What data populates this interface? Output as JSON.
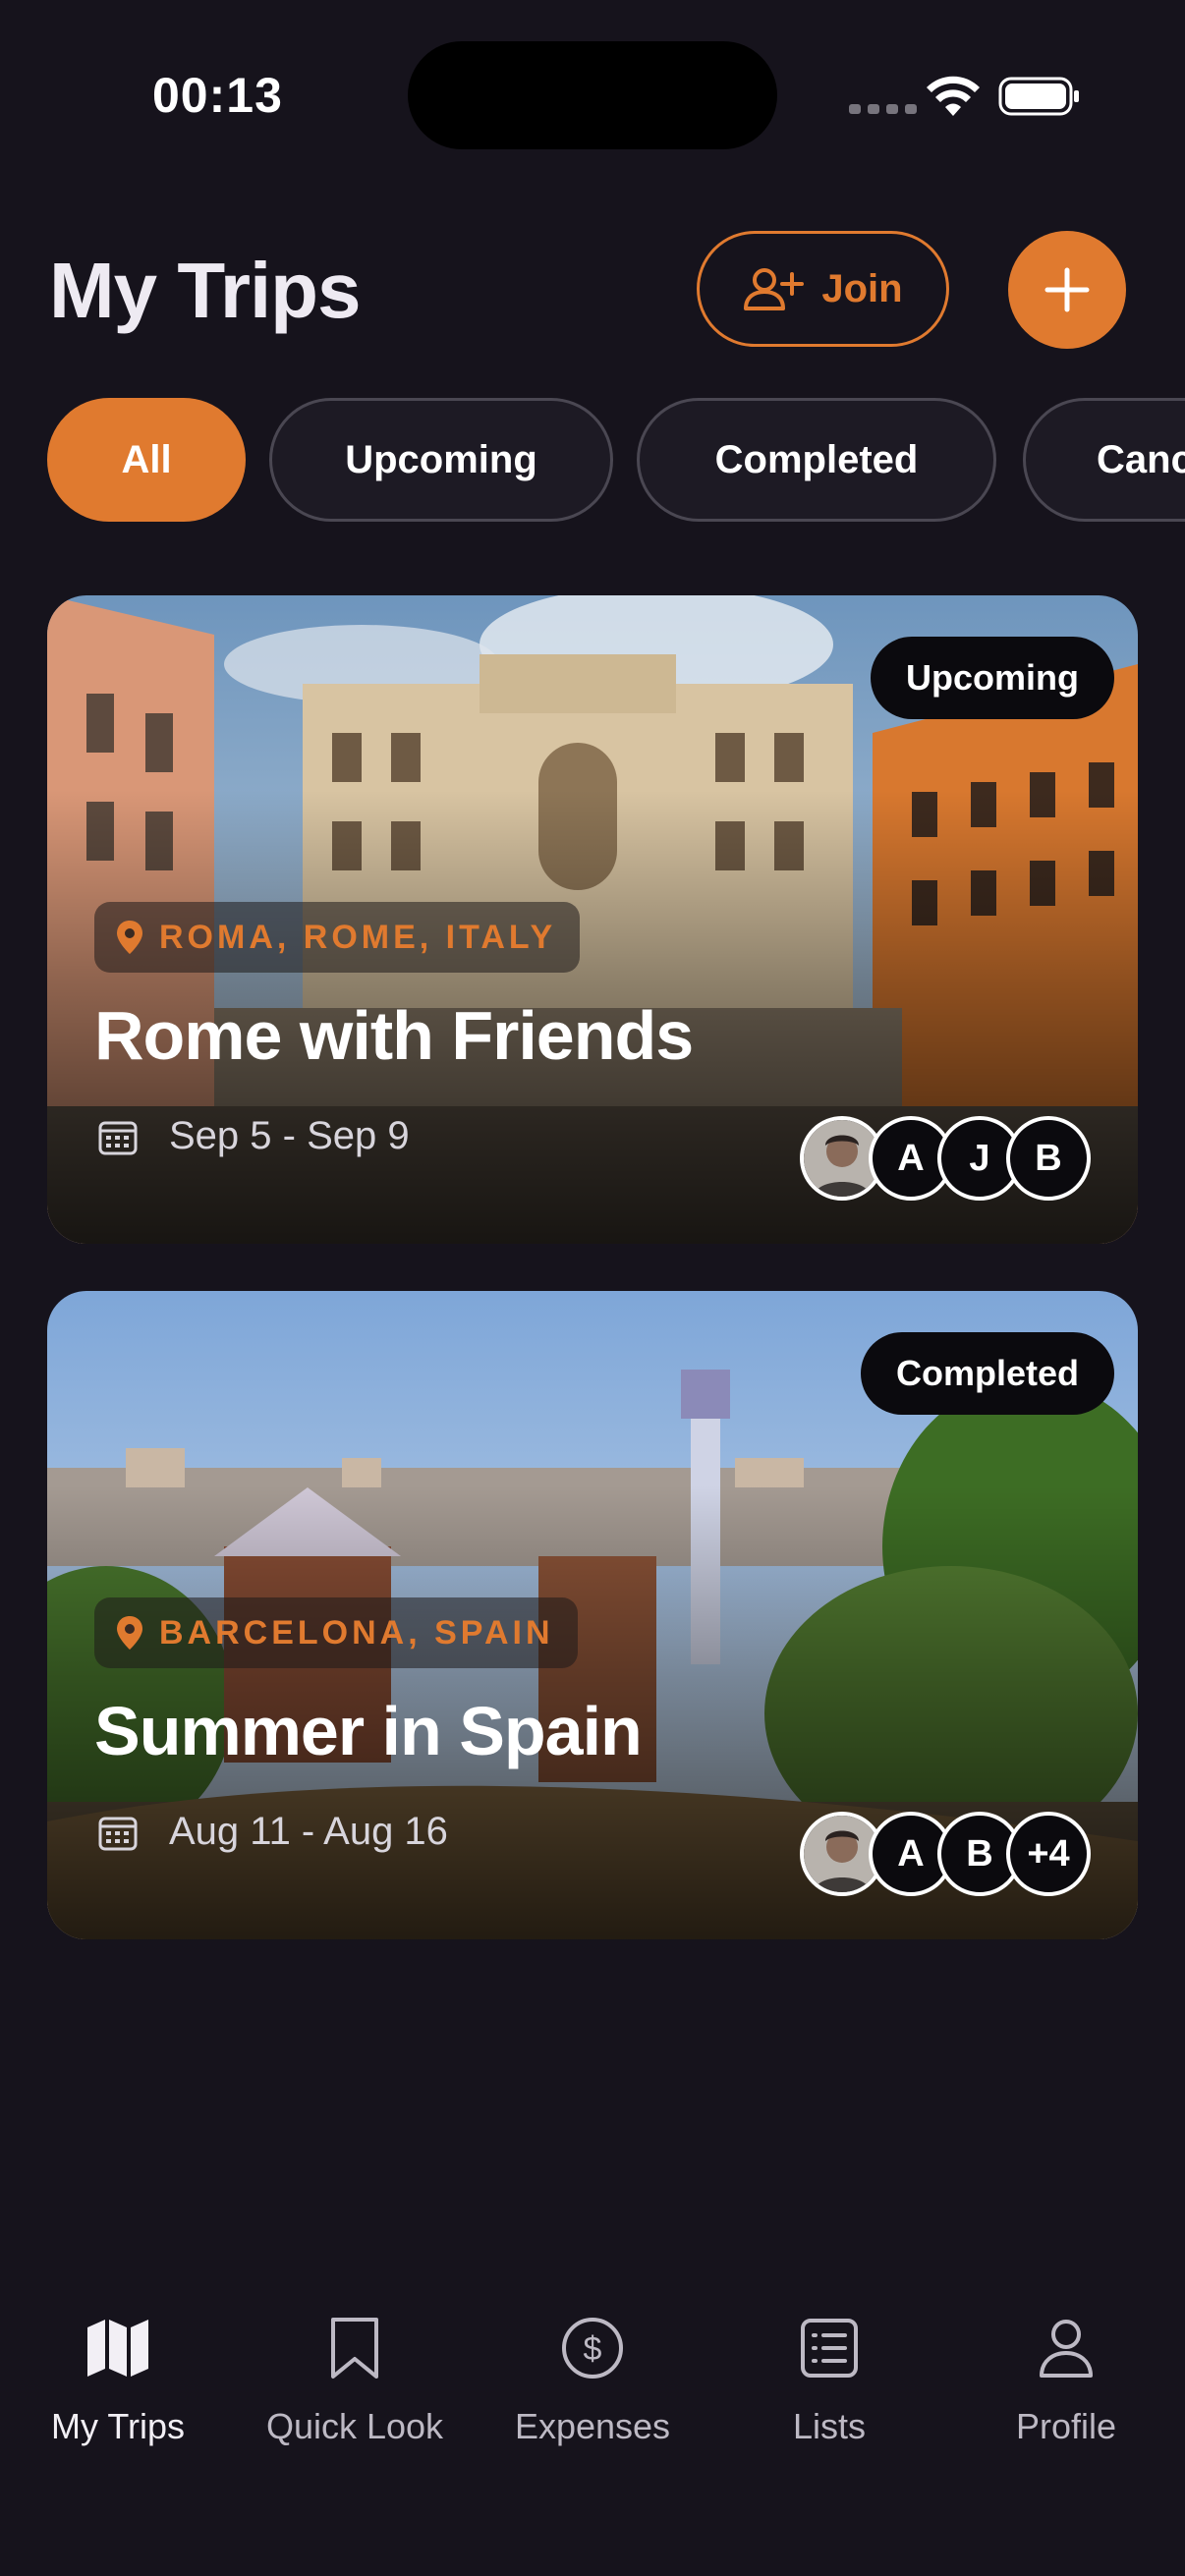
{
  "status_bar": {
    "time": "00:13"
  },
  "header": {
    "title": "My Trips",
    "join_label": "Join",
    "add_icon": "plus-icon"
  },
  "filters": {
    "chips": [
      "All",
      "Upcoming",
      "Completed",
      "Canc"
    ],
    "selected": "All"
  },
  "trips": [
    {
      "status": "Upcoming",
      "location": "ROMA, ROME, ITALY",
      "title": "Rome with Friends",
      "dates": "Sep 5 - Sep 9",
      "avatars": [
        "",
        "A",
        "J",
        "B"
      ]
    },
    {
      "status": "Completed",
      "location": "BARCELONA, SPAIN",
      "title": "Summer in Spain",
      "dates": "Aug 11 - Aug 16",
      "avatars": [
        "",
        "A",
        "B",
        "+4"
      ]
    }
  ],
  "tab_bar": {
    "items": [
      {
        "label": "My Trips",
        "icon": "map-icon"
      },
      {
        "label": "Quick Look",
        "icon": "bookmark-icon"
      },
      {
        "label": "Expenses",
        "icon": "dollar-circle-icon"
      },
      {
        "label": "Lists",
        "icon": "list-icon"
      },
      {
        "label": "Profile",
        "icon": "person-icon"
      }
    ],
    "active": "My Trips"
  },
  "colors": {
    "accent": "#e07a2f",
    "background": "#16131c",
    "badge": "#0b0a0e"
  }
}
